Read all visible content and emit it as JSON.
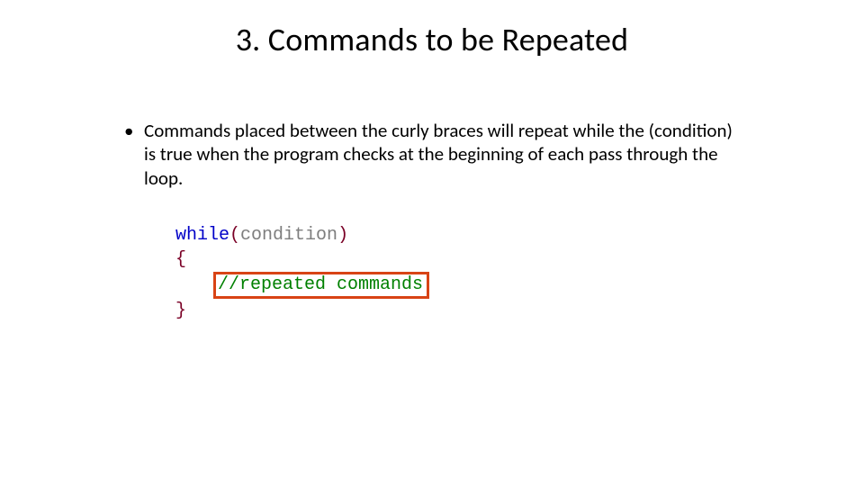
{
  "title": "3. Commands to be Repeated",
  "bullet": "Commands placed between the curly braces will repeat while the (condition) is true when the program checks at the beginning of each pass through the loop.",
  "code": {
    "kw_while": "while",
    "paren_open": "(",
    "identifier": "condition",
    "paren_close": ")",
    "brace_open": "{",
    "comment": "//repeated commands",
    "brace_close": "}"
  },
  "colors": {
    "keyword": "#0000c8",
    "punct": "#7a0026",
    "ident": "#7e7e7e",
    "comment": "#008000",
    "highlight_border": "#d84315"
  }
}
